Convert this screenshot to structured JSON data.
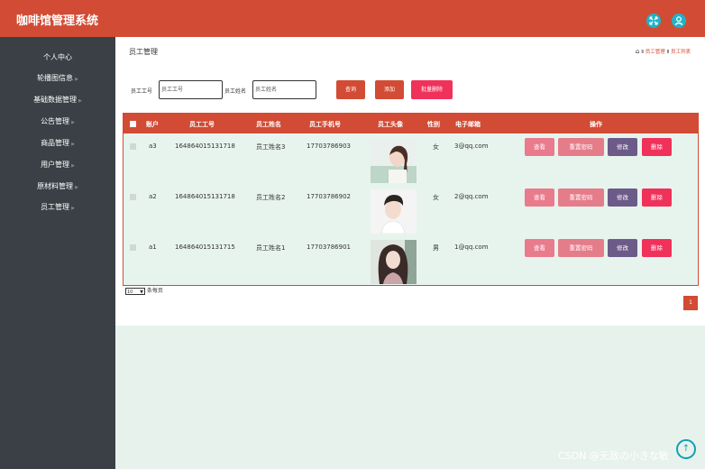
{
  "header": {
    "title": "咖啡馆管理系统",
    "icon_left": "expand-icon",
    "icon_right": "user-icon"
  },
  "sidebar": {
    "items": [
      {
        "label": "个人中心",
        "has_arrow": false
      },
      {
        "label": "轮播图信息",
        "has_arrow": true
      },
      {
        "label": "基础数据管理",
        "has_arrow": true
      },
      {
        "label": "公告管理",
        "has_arrow": true
      },
      {
        "label": "商品管理",
        "has_arrow": true
      },
      {
        "label": "用户管理",
        "has_arrow": true
      },
      {
        "label": "原材料管理",
        "has_arrow": true
      },
      {
        "label": "员工管理",
        "has_arrow": true
      }
    ]
  },
  "page": {
    "title": "员工管理",
    "breadcrumb": [
      "员工管理",
      "员工列表"
    ]
  },
  "search": {
    "id_label": "员工工号",
    "id_placeholder": "员工工号",
    "name_label": "员工姓名",
    "name_placeholder": "员工姓名",
    "query_button": "查询",
    "add_button": "添加",
    "batch_delete_button": "批量删除"
  },
  "table": {
    "headers": [
      "账户",
      "员工工号",
      "员工姓名",
      "员工手机号",
      "员工头像",
      "性别",
      "电子邮箱",
      "操作"
    ],
    "rows": [
      {
        "account": "a3",
        "emp_id": "164864015131718",
        "name": "员工姓名3",
        "phone": "17703786903",
        "gender": "女",
        "email": "3@qq.com"
      },
      {
        "account": "a2",
        "emp_id": "164864015131718",
        "name": "员工姓名2",
        "phone": "17703786902",
        "gender": "女",
        "email": "2@qq.com"
      },
      {
        "account": "a1",
        "emp_id": "164864015131715",
        "name": "员工姓名1",
        "phone": "17703786901",
        "gender": "男",
        "email": "1@qq.com"
      }
    ],
    "actions": {
      "view": "查看",
      "reset_password": "重置密码",
      "edit": "修改",
      "delete": "删除"
    }
  },
  "pagination": {
    "page_size": "10",
    "per_page_label": "条每页",
    "current_page": "1"
  },
  "watermark": "CSDN @无敌の小きな敏",
  "colors": {
    "primary": "#d24b34",
    "sidebar": "#3a4045",
    "accent": "#1fb3c8",
    "row_bg": "#e7f4ed",
    "view_btn": "#e97b8c",
    "reset_btn": "#e57c8a",
    "edit_btn": "#6c5b88",
    "delete_btn": "#f0315a"
  }
}
